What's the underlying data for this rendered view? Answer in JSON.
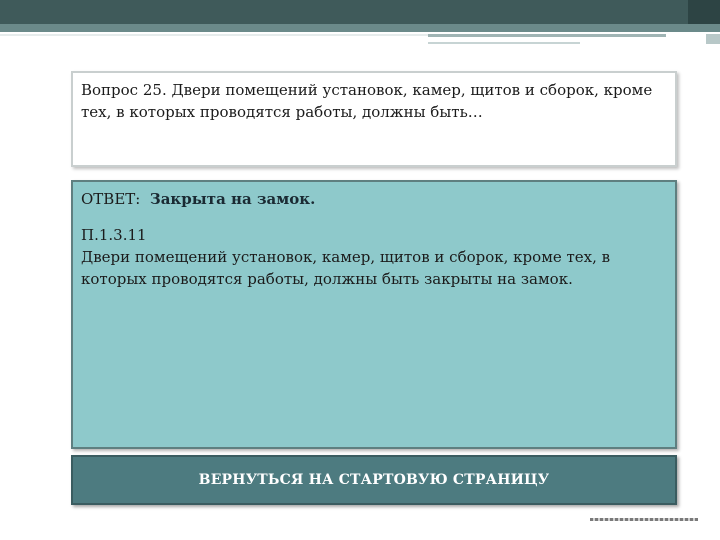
{
  "question": {
    "text": "Вопрос 25. Двери помещений установок, камер, щитов и сборок, кроме тех, в которых проводятся работы, должны быть…"
  },
  "answer": {
    "label": "ОТВЕТ:",
    "value": "Закрыта на замок.",
    "reference": "П.1.3.11",
    "explanation": "Двери помещений установок, камер, щитов и сборок,  кроме тех, в которых проводятся работы, должны быть закрыты на замок."
  },
  "navigation": {
    "return_label": "ВЕРНУТЬСЯ  НА СТАРТОВУЮ СТРАНИЦУ"
  },
  "colors": {
    "header_band": "#3f5a5a",
    "answer_background": "#8ec9cb",
    "button_background": "#4d7b80"
  }
}
